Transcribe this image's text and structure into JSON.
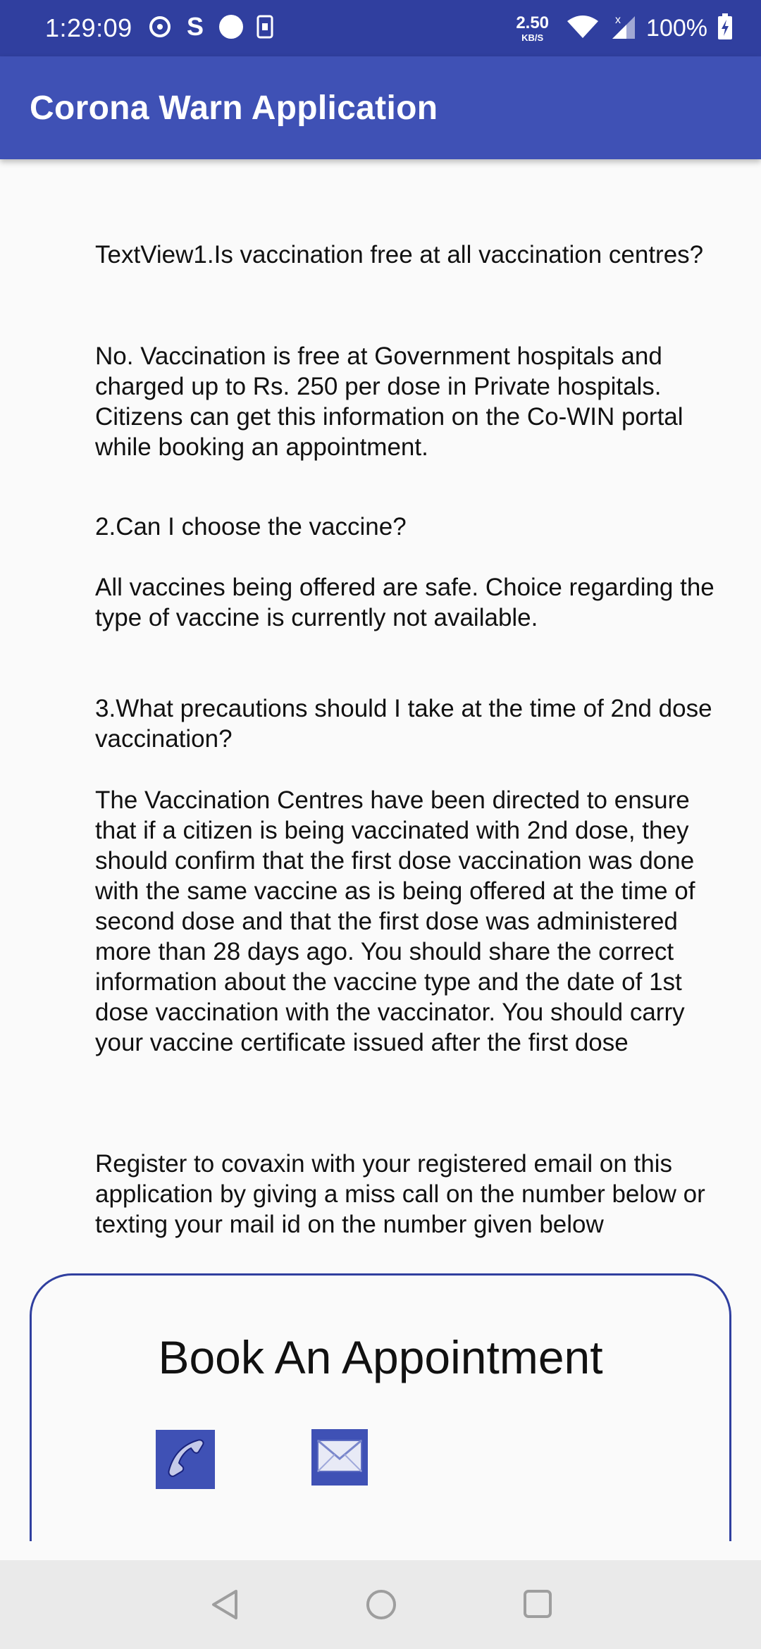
{
  "status_bar": {
    "time": "1:29:09",
    "speed_value": "2.50",
    "speed_unit": "KB/S",
    "battery": "100%",
    "icons": [
      "target-icon",
      "skype-icon",
      "circle-icon",
      "sim-icon",
      "wifi-icon",
      "signal-icon",
      "battery-charging-icon"
    ]
  },
  "app_bar": {
    "title": "Corona Warn Application"
  },
  "content": {
    "q1": "TextView1.Is vaccination free at all vaccination centres?",
    "a1": "No. Vaccination is free at Government hospitals and charged up to Rs. 250 per dose in Private hospitals. Citizens can get this information on the Co-WIN portal while booking an appointment.",
    "q2": "2.Can I choose the vaccine?",
    "a2": "All vaccines being offered are safe. Choice regarding the type of vaccine is currently not available.",
    "q3": "3.What precautions should I take at the time of 2nd dose vaccination?",
    "a3": "The Vaccination Centres have been directed to ensure that if a citizen is being vaccinated with 2nd dose, they should confirm that the first dose vaccination was done with the same vaccine as is being offered at the time of second dose and that the first dose was administered more than 28 days ago. You should share the correct information about the vaccine type and the date of 1st dose vaccination with the vaccinator. You should carry your vaccine certificate issued after the first dose",
    "register_text": "Register to covaxin with your registered email on this application by giving a miss call on the number below or texting your mail id on the number given below"
  },
  "booking": {
    "title": "Book An Appointment",
    "call_icon": "phone-icon",
    "mail_icon": "mail-icon"
  },
  "nav_bar": {
    "icons": [
      "back-icon",
      "home-icon",
      "recents-icon"
    ]
  },
  "colors": {
    "status_bar": "#303f9f",
    "app_bar": "#3f51b5",
    "accent": "#3f51b5",
    "background": "#fafafa"
  }
}
